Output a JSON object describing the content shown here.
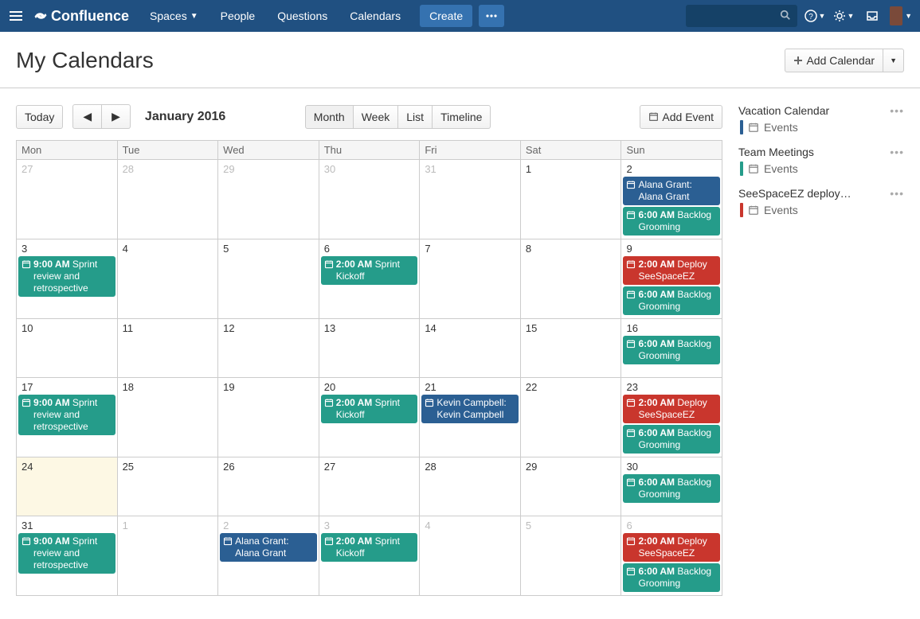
{
  "nav": {
    "logo": "Confluence",
    "items": [
      "Spaces",
      "People",
      "Questions",
      "Calendars"
    ],
    "create": "Create"
  },
  "page": {
    "title": "My Calendars",
    "add_calendar": "Add Calendar"
  },
  "toolbar": {
    "today": "Today",
    "label": "January 2016",
    "views": [
      "Month",
      "Week",
      "List",
      "Timeline"
    ],
    "active_view": "Month",
    "add_event": "Add Event"
  },
  "weekdays": [
    "Mon",
    "Tue",
    "Wed",
    "Thu",
    "Fri",
    "Sat",
    "Sun"
  ],
  "weeks": [
    [
      {
        "n": "27",
        "other": true
      },
      {
        "n": "28",
        "other": true
      },
      {
        "n": "29",
        "other": true
      },
      {
        "n": "30",
        "other": true
      },
      {
        "n": "31",
        "other": true
      },
      {
        "n": "1"
      },
      {
        "n": "2",
        "events": [
          {
            "color": "blue",
            "title": "Alana Grant: Alana Grant"
          },
          {
            "color": "teal",
            "time": "6:00 AM",
            "title": "Backlog Grooming"
          }
        ]
      }
    ],
    [
      {
        "n": "3",
        "events": [
          {
            "color": "teal",
            "time": "9:00 AM",
            "title": "Sprint review and retrospective"
          }
        ]
      },
      {
        "n": "4"
      },
      {
        "n": "5"
      },
      {
        "n": "6",
        "events": [
          {
            "color": "teal",
            "time": "2:00 AM",
            "title": "Sprint Kickoff"
          }
        ]
      },
      {
        "n": "7"
      },
      {
        "n": "8"
      },
      {
        "n": "9",
        "events": [
          {
            "color": "red",
            "time": "2:00 AM",
            "title": "Deploy SeeSpaceEZ"
          },
          {
            "color": "teal",
            "time": "6:00 AM",
            "title": "Backlog Grooming"
          }
        ]
      }
    ],
    [
      {
        "n": "10"
      },
      {
        "n": "11"
      },
      {
        "n": "12"
      },
      {
        "n": "13"
      },
      {
        "n": "14"
      },
      {
        "n": "15"
      },
      {
        "n": "16",
        "events": [
          {
            "color": "teal",
            "time": "6:00 AM",
            "title": "Backlog Grooming"
          }
        ]
      }
    ],
    [
      {
        "n": "17",
        "events": [
          {
            "color": "teal",
            "time": "9:00 AM",
            "title": "Sprint review and retrospective"
          }
        ]
      },
      {
        "n": "18"
      },
      {
        "n": "19"
      },
      {
        "n": "20",
        "events": [
          {
            "color": "teal",
            "time": "2:00 AM",
            "title": "Sprint Kickoff"
          }
        ]
      },
      {
        "n": "21",
        "events": [
          {
            "color": "blue",
            "title": "Kevin Campbell: Kevin Campbell"
          }
        ]
      },
      {
        "n": "22"
      },
      {
        "n": "23",
        "events": [
          {
            "color": "red",
            "time": "2:00 AM",
            "title": "Deploy SeeSpaceEZ"
          },
          {
            "color": "teal",
            "time": "6:00 AM",
            "title": "Backlog Grooming"
          }
        ]
      }
    ],
    [
      {
        "n": "24",
        "today": true
      },
      {
        "n": "25"
      },
      {
        "n": "26"
      },
      {
        "n": "27"
      },
      {
        "n": "28"
      },
      {
        "n": "29"
      },
      {
        "n": "30",
        "events": [
          {
            "color": "teal",
            "time": "6:00 AM",
            "title": "Backlog Grooming"
          }
        ]
      }
    ],
    [
      {
        "n": "31",
        "events": [
          {
            "color": "teal",
            "time": "9:00 AM",
            "title": "Sprint review and retrospective"
          }
        ]
      },
      {
        "n": "1",
        "other": true
      },
      {
        "n": "2",
        "other": true,
        "events": [
          {
            "color": "blue",
            "title": "Alana Grant: Alana Grant"
          }
        ]
      },
      {
        "n": "3",
        "other": true,
        "events": [
          {
            "color": "teal",
            "time": "2:00 AM",
            "title": "Sprint Kickoff"
          }
        ]
      },
      {
        "n": "4",
        "other": true
      },
      {
        "n": "5",
        "other": true
      },
      {
        "n": "6",
        "other": true,
        "events": [
          {
            "color": "red",
            "time": "2:00 AM",
            "title": "Deploy SeeSpaceEZ"
          },
          {
            "color": "teal",
            "time": "6:00 AM",
            "title": "Backlog Grooming"
          }
        ]
      }
    ]
  ],
  "sidebar": {
    "events_label": "Events",
    "calendars": [
      {
        "name": "Vacation Calendar",
        "color": "blue"
      },
      {
        "name": "Team Meetings",
        "color": "teal"
      },
      {
        "name": "SeeSpaceEZ deploy…",
        "color": "red"
      }
    ]
  }
}
